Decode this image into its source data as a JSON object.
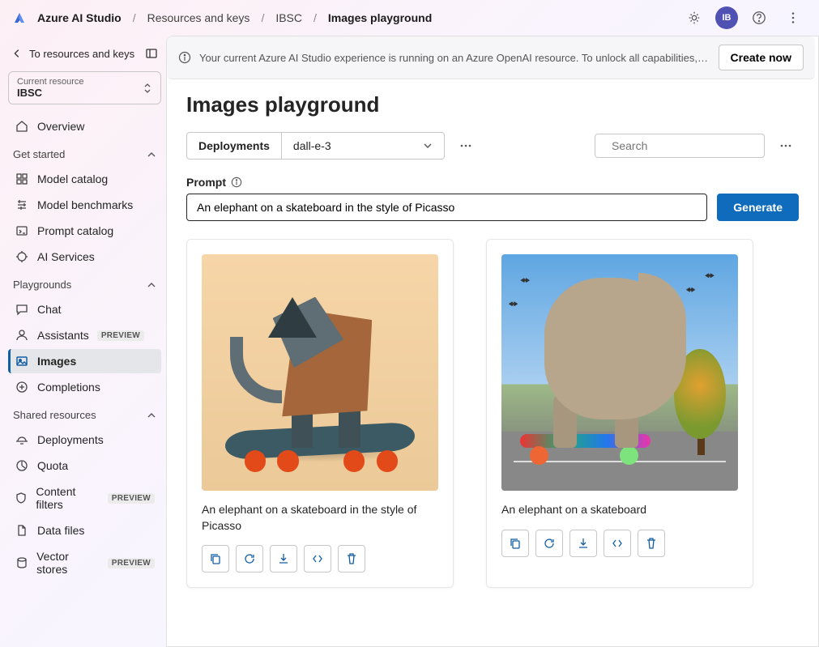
{
  "header": {
    "app_name": "Azure AI Studio",
    "crumbs": [
      "Resources and keys",
      "IBSC",
      "Images playground"
    ],
    "avatar_initials": "IB"
  },
  "sidebar": {
    "back_label": "To resources and keys",
    "resource_label": "Current resource",
    "resource_value": "IBSC",
    "overview": "Overview",
    "sections": {
      "get_started": "Get started",
      "playgrounds": "Playgrounds",
      "shared": "Shared resources"
    },
    "get_started_items": [
      "Model catalog",
      "Model benchmarks",
      "Prompt catalog",
      "AI Services"
    ],
    "playgrounds_items": [
      {
        "label": "Chat",
        "badge": null,
        "active": false
      },
      {
        "label": "Assistants",
        "badge": "PREVIEW",
        "active": false
      },
      {
        "label": "Images",
        "badge": null,
        "active": true
      },
      {
        "label": "Completions",
        "badge": null,
        "active": false
      }
    ],
    "shared_items": [
      {
        "label": "Deployments",
        "badge": null
      },
      {
        "label": "Quota",
        "badge": null
      },
      {
        "label": "Content filters",
        "badge": "PREVIEW"
      },
      {
        "label": "Data files",
        "badge": null
      },
      {
        "label": "Vector stores",
        "badge": "PREVIEW"
      }
    ]
  },
  "banner": {
    "message": "Your current Azure AI Studio experience is running on an Azure OpenAI resource. To unlock all capabilities, create a…",
    "button": "Create now"
  },
  "main": {
    "title": "Images playground",
    "deployments_label": "Deployments",
    "deployment_selected": "dall-e-3",
    "search_placeholder": "Search",
    "prompt_label": "Prompt",
    "prompt_value": "An elephant on a skateboard in the style of Picasso",
    "generate_button": "Generate"
  },
  "results": [
    {
      "caption": "An elephant on a skateboard in the style of Picasso"
    },
    {
      "caption": "An elephant on a skateboard"
    }
  ]
}
